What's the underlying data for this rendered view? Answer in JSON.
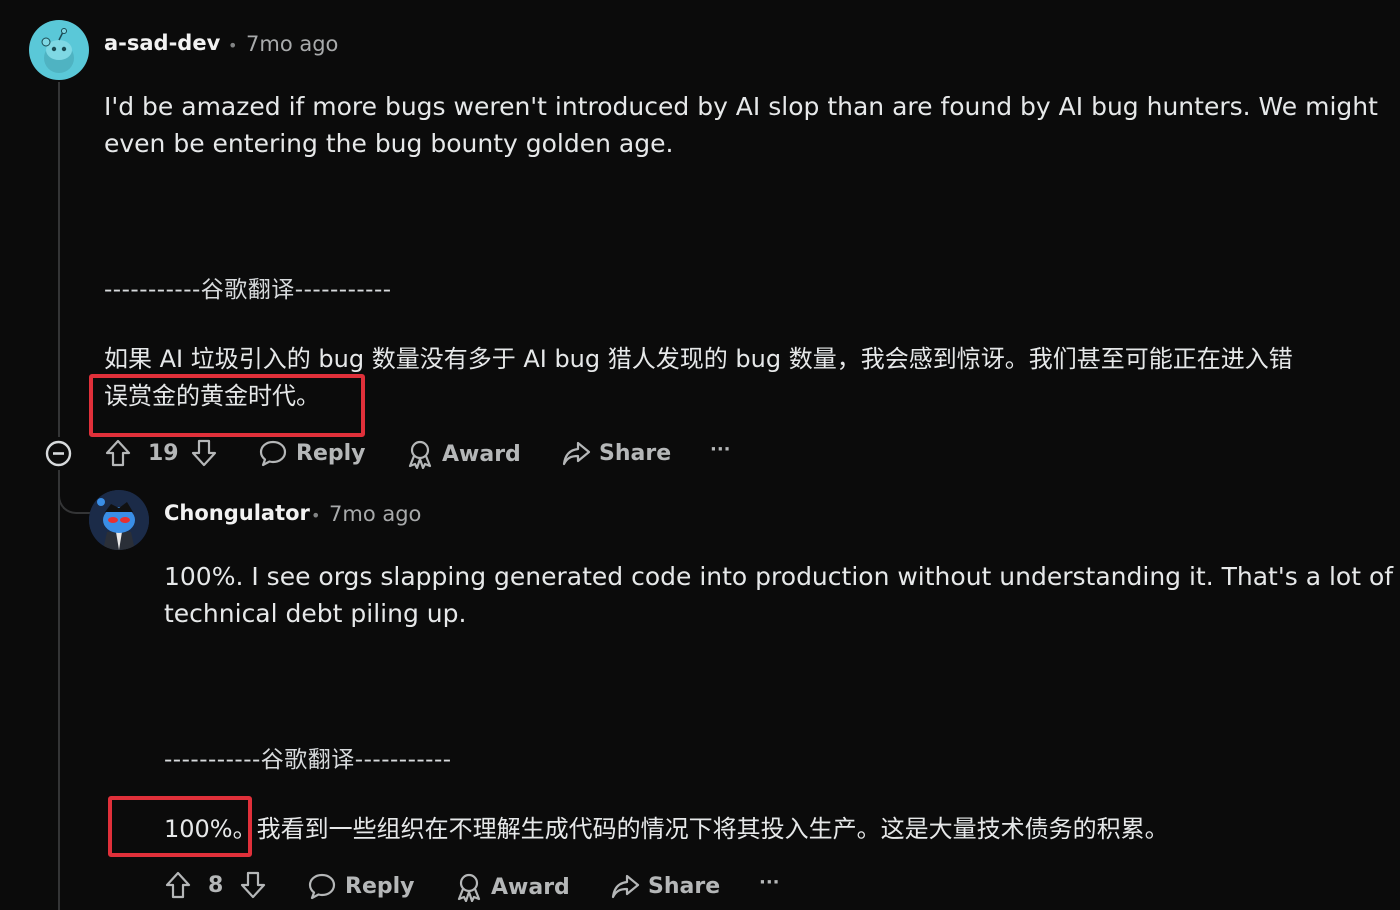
{
  "comments": [
    {
      "username": "a-sad-dev",
      "time": "7mo ago",
      "body_line1": "I'd be amazed if more bugs weren't introduced by AI slop than are found by AI bug hunters. We might",
      "body_line2": "even be entering the bug bounty golden age.",
      "separator": "-----------谷歌翻译-----------",
      "translation_line1": "如果 AI 垃圾引入的 bug 数量没有多于 AI bug 猎人发现的 bug 数量，我会感到惊讶。我们甚至可能正在进入错",
      "translation_line2": "误赏金的黄金时代。",
      "votes": "19",
      "reply_label": "Reply",
      "award_label": "Award",
      "share_label": "Share",
      "more_label": "···"
    },
    {
      "username": "Chongulator",
      "time": "7mo ago",
      "body_line1": "100%. I see orgs slapping generated code into production without understanding it. That's a lot of",
      "body_line2": "technical debt piling up.",
      "separator": "-----------谷歌翻译-----------",
      "translation_line1_highlight": "100%。",
      "translation_line1_rest": "我看到一些组织在不理解生成代码的情况下将其投入生产。这是大量技术债务的积累。",
      "votes": "8",
      "reply_label": "Reply",
      "award_label": "Award",
      "share_label": "Share",
      "more_label": "···"
    }
  ],
  "colors": {
    "background": "#0b0b0b",
    "highlight_box": "#e0303a",
    "avatar1": "#5ac8d8",
    "avatar2_bg": "#1b2b48"
  },
  "dot_separator": "•"
}
